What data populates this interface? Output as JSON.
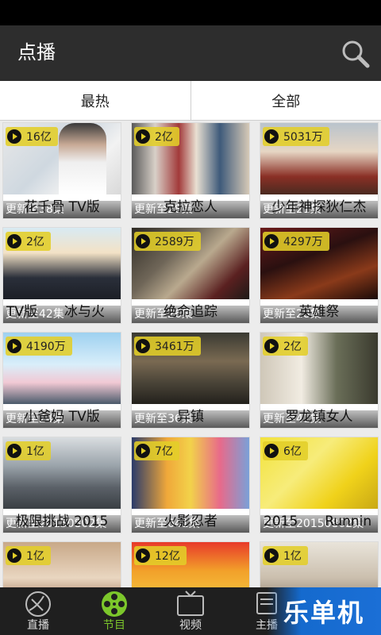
{
  "header": {
    "title": "点播"
  },
  "filters": [
    {
      "label": "最热"
    },
    {
      "label": "全部"
    }
  ],
  "cards": [
    {
      "count": "16亿",
      "update": "更新至38集",
      "title": "花千骨 TV版"
    },
    {
      "count": "2亿",
      "update": "更新至28集",
      "title": "克拉恋人"
    },
    {
      "count": "5031万",
      "update": "更新至21集",
      "title": "少年神探狄仁杰"
    },
    {
      "count": "2亿",
      "update": "更新至42集",
      "title": "TV版　　冰与火"
    },
    {
      "count": "2589万",
      "update": "更新至26集",
      "title": "绝命追踪"
    },
    {
      "count": "4297万",
      "update": "更新至28集",
      "title": "英雄祭"
    },
    {
      "count": "4190万",
      "update": "更新至24集",
      "title": "小爸妈 TV版"
    },
    {
      "count": "3461万",
      "update": "更新至36集",
      "title": "异镇"
    },
    {
      "count": "2亿",
      "update": "更新至41集",
      "title": "罗龙镇女人"
    },
    {
      "count": "1亿",
      "update": "更新至20150802集",
      "title": "极限挑战 2015"
    },
    {
      "count": "7亿",
      "update": "更新至641集",
      "title": "火影忍者"
    },
    {
      "count": "6亿",
      "update": "更新至20150802集",
      "title": "2015　　Runnin"
    },
    {
      "count": "1亿",
      "update": "",
      "title": ""
    },
    {
      "count": "12亿",
      "update": "",
      "title": ""
    },
    {
      "count": "1亿",
      "update": "",
      "title": ""
    }
  ],
  "nav": [
    {
      "label": "直播",
      "icon": "satellite-dish-icon"
    },
    {
      "label": "节目",
      "icon": "film-reel-icon"
    },
    {
      "label": "视频",
      "icon": "tv-icon"
    },
    {
      "label": "主播",
      "icon": "anchor-icon"
    }
  ],
  "watermark": "乐单机",
  "colors": {
    "accent": "#7cc72b",
    "badge": "#e2ce28",
    "appbar": "#2d2d2d"
  }
}
